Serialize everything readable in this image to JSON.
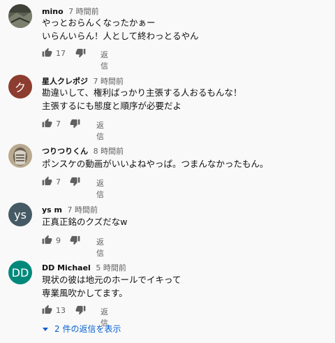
{
  "comments": [
    {
      "author": "mino",
      "time": "7 時間前",
      "lines": [
        "やっとおらんくなったかぁー",
        "いらんいらん！人として終わっとるやん"
      ],
      "likes": "17",
      "reply": "返信",
      "avatar": {
        "type": "photo",
        "color": "#5b5e52"
      }
    },
    {
      "author": "星人クレポジ",
      "time": "7 時間前",
      "lines": [
        "勘違いして、権利ばっかり主張する人おるもんな！",
        "主張するにも態度と順序が必要だよ"
      ],
      "likes": "7",
      "reply": "返信",
      "avatar": {
        "type": "letter",
        "letter": "ク",
        "color": "#8d3d2f"
      }
    },
    {
      "author": "つりつりくん",
      "time": "8 時間前",
      "lines": [
        "ポンスケの動画がいいよねやっぱ。つまんなかったもん。"
      ],
      "likes": "7",
      "reply": "返信",
      "avatar": {
        "type": "photo",
        "color": "#8c7a63"
      }
    },
    {
      "author": "ys m",
      "time": "7 時間前",
      "lines": [
        "正真正銘のクズだなw"
      ],
      "likes": "9",
      "reply": "返信",
      "avatar": {
        "type": "letter",
        "letter": "ys",
        "color": "#455a64"
      }
    },
    {
      "author": "DD Michael",
      "time": "5 時間前",
      "lines": [
        "現状の彼は地元のホールでイキって",
        "専業風吹かしてます。"
      ],
      "likes": "13",
      "reply": "返信",
      "avatar": {
        "type": "letter",
        "letter": "DD",
        "color": "#00897b"
      }
    }
  ],
  "more_replies": "2 件の返信を表示",
  "colors": {
    "link": "#065fd4",
    "secondary": "#606060",
    "background": "#f9f9f9"
  },
  "icons": {
    "like": "thumb-up-icon",
    "dislike": "thumb-down-icon",
    "expand": "caret-down-icon"
  }
}
